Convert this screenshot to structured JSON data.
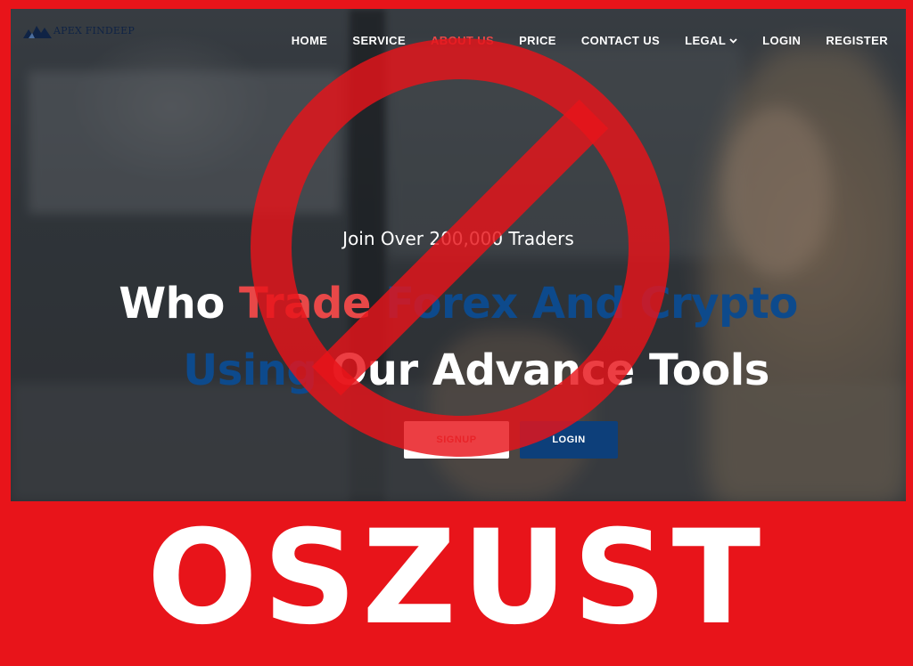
{
  "brand": {
    "name": "APEX FINDEEP",
    "color": "#0f2345"
  },
  "nav": {
    "items": [
      {
        "label": "HOME"
      },
      {
        "label": "SERVICE"
      },
      {
        "label": "ABOUT US"
      },
      {
        "label": "PRICE"
      },
      {
        "label": "CONTACT US"
      },
      {
        "label": "LEGAL",
        "icon": "chevron-down-icon"
      },
      {
        "label": "LOGIN"
      },
      {
        "label": "REGISTER"
      }
    ]
  },
  "hero": {
    "tagline": "Join Over 200,000 Traders",
    "headline_line1": [
      "Who",
      "Trade",
      "Forex",
      "And",
      "Crypto"
    ],
    "headline_line2": [
      "Using",
      "Our",
      "Advance",
      "Tools"
    ],
    "signup_label": "SIGNUP",
    "login_label": "LOGIN"
  },
  "overlay": {
    "warning_label": "OSZUST",
    "icon": "prohibition-icon",
    "color": "#e8141a"
  },
  "colors": {
    "accent_blue": "#0d4a8c",
    "button_blue": "#0d3f7a",
    "alert_red": "#e8141a"
  }
}
